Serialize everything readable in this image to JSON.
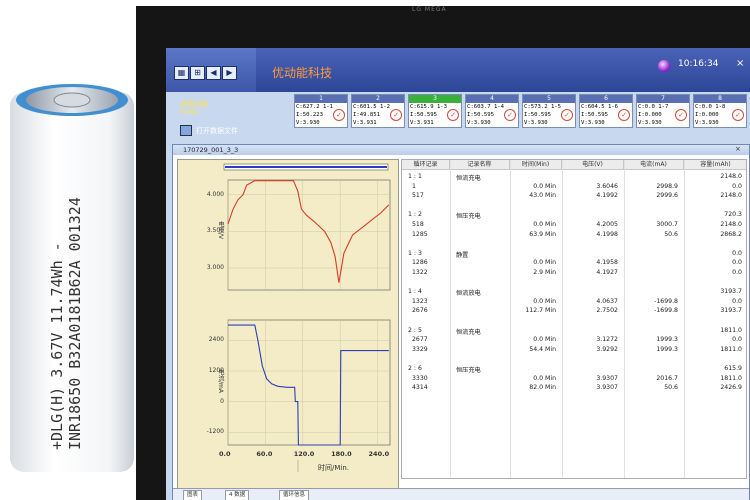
{
  "battery": {
    "label_line1": "+DLG(H) 3.67V 11.74Wh -",
    "label_line2": "INR18650 B32A0181B62A 001324"
  },
  "monitor": {
    "brand": "LG MEGA"
  },
  "app": {
    "title": "优动能科技",
    "time": "10:16:34",
    "sys_func_cn": "系统功能",
    "sys_func_en": "FUNC",
    "open_file": "打开数据文件",
    "close": "×",
    "colors": {
      "topbar": "#3a52a6",
      "title": "#ff9a3c",
      "active_channel": "#39b039"
    }
  },
  "channels": [
    {
      "num": "1",
      "c": "C:627.2 1-1",
      "i": "I:50.223",
      "v": "V:3.930"
    },
    {
      "num": "2",
      "c": "C:601.5 1-2",
      "i": "I:49.851",
      "v": "V:3.931"
    },
    {
      "num": "3",
      "c": "C:615.9 1-3",
      "i": "I:50.595",
      "v": "V:3.931"
    },
    {
      "num": "4",
      "c": "C:603.7 1-4",
      "i": "I:50.595",
      "v": "V:3.930"
    },
    {
      "num": "5",
      "c": "C:573.2 1-5",
      "i": "I:50.595",
      "v": "V:3.930"
    },
    {
      "num": "6",
      "c": "C:604.5 1-6",
      "i": "I:50.595",
      "v": "V:3.930"
    },
    {
      "num": "7",
      "c": "C:0.0 1-7",
      "i": "I:0.000",
      "v": "V:3.930"
    },
    {
      "num": "8",
      "c": "C:0.0 1-8",
      "i": "I:0.000",
      "v": "V:3.930"
    }
  ],
  "datawin": {
    "title": "170729_001_3_3",
    "close": "×",
    "tabs": [
      "图表",
      "4 数据",
      "循环信息"
    ]
  },
  "chart_data": {
    "type": "line",
    "xlabel": "时间/Min.",
    "x_ticks": [
      "0.0",
      "60.0",
      "120.0",
      "180.0",
      "240.0"
    ],
    "xlim": [
      0,
      260
    ],
    "panels": [
      {
        "ylabel": "电压/V",
        "y_ticks": [
          "4.000",
          "3.500",
          "3.000"
        ],
        "ylim": [
          2.7,
          4.2
        ],
        "series": [
          {
            "color": "#d63c2a",
            "x": [
              0,
              8,
              16,
              24,
              30,
              43,
              50,
              60,
              75,
              90,
              105,
              112,
              118,
              126,
              140,
              155,
              165,
              172,
              178,
              186,
              200,
              215,
              230,
              245,
              258
            ],
            "y": [
              3.6,
              3.8,
              3.93,
              4.0,
              4.13,
              4.19,
              4.19,
              4.19,
              4.19,
              4.19,
              4.19,
              4.05,
              3.8,
              3.72,
              3.62,
              3.5,
              3.35,
              3.15,
              2.8,
              3.2,
              3.45,
              3.55,
              3.65,
              3.75,
              3.86
            ]
          }
        ]
      },
      {
        "ylabel": "电流/mA",
        "y_ticks": [
          "2400",
          "1200",
          "0",
          "-1200"
        ],
        "ylim": [
          -1700,
          3200
        ],
        "series": [
          {
            "color": "#2c3fb8",
            "x": [
              0,
              43,
              48,
              55,
              62,
              70,
              80,
              95,
              107,
              108,
              112,
              113,
              170,
              180,
              181,
              200,
              230,
              258
            ],
            "y": [
              3000,
              3000,
              2400,
              1400,
              900,
              700,
              600,
              560,
              560,
              0,
              0,
              -1700,
              -1700,
              -1700,
              2000,
              2000,
              2000,
              2000
            ]
          }
        ]
      }
    ]
  },
  "table": {
    "headers": [
      "循环记录",
      "记录名称",
      "时间(Min)",
      "电压(V)",
      "电流(mA)",
      "容量(mAh)"
    ],
    "rows": [
      [
        "1 : 1",
        "恒流充电",
        "",
        "",
        "",
        "2148.0"
      ],
      [
        "1",
        "",
        "0.0 Min",
        "3.6046",
        "2998.9",
        "0.0"
      ],
      [
        "517",
        "",
        "43.0 Min",
        "4.1992",
        "2999.6",
        "2148.0"
      ],
      [
        "",
        "",
        "",
        "",
        "",
        ""
      ],
      [
        "1 : 2",
        "恒压充电",
        "",
        "",
        "",
        "720.3"
      ],
      [
        "518",
        "",
        "0.0 Min",
        "4.2005",
        "3000.7",
        "2148.0"
      ],
      [
        "1285",
        "",
        "63.9 Min",
        "4.1998",
        "50.6",
        "2868.2"
      ],
      [
        "",
        "",
        "",
        "",
        "",
        ""
      ],
      [
        "1 : 3",
        "静置",
        "",
        "",
        "",
        "0.0"
      ],
      [
        "1286",
        "",
        "0.0 Min",
        "4.1958",
        "",
        "0.0"
      ],
      [
        "1322",
        "",
        "2.9 Min",
        "4.1927",
        "",
        "0.0"
      ],
      [
        "",
        "",
        "",
        "",
        "",
        ""
      ],
      [
        "1 : 4",
        "恒流放电",
        "",
        "",
        "",
        "3193.7"
      ],
      [
        "1323",
        "",
        "0.0 Min",
        "4.0637",
        "-1699.8",
        "0.0"
      ],
      [
        "2676",
        "",
        "112.7 Min",
        "2.7502",
        "-1699.8",
        "3193.7"
      ],
      [
        "",
        "",
        "",
        "",
        "",
        ""
      ],
      [
        "2 : 5",
        "恒流充电",
        "",
        "",
        "",
        "1811.0"
      ],
      [
        "2677",
        "",
        "0.0 Min",
        "3.1272",
        "1999.3",
        "0.0"
      ],
      [
        "3329",
        "",
        "54.4 Min",
        "3.9292",
        "1999.3",
        "1811.0"
      ],
      [
        "",
        "",
        "",
        "",
        "",
        ""
      ],
      [
        "2 : 6",
        "恒压充电",
        "",
        "",
        "",
        "615.9"
      ],
      [
        "3330",
        "",
        "0.0 Min",
        "3.9307",
        "2016.7",
        "1811.0"
      ],
      [
        "4314",
        "",
        "82.0 Min",
        "3.9307",
        "50.6",
        "2426.9"
      ]
    ]
  }
}
